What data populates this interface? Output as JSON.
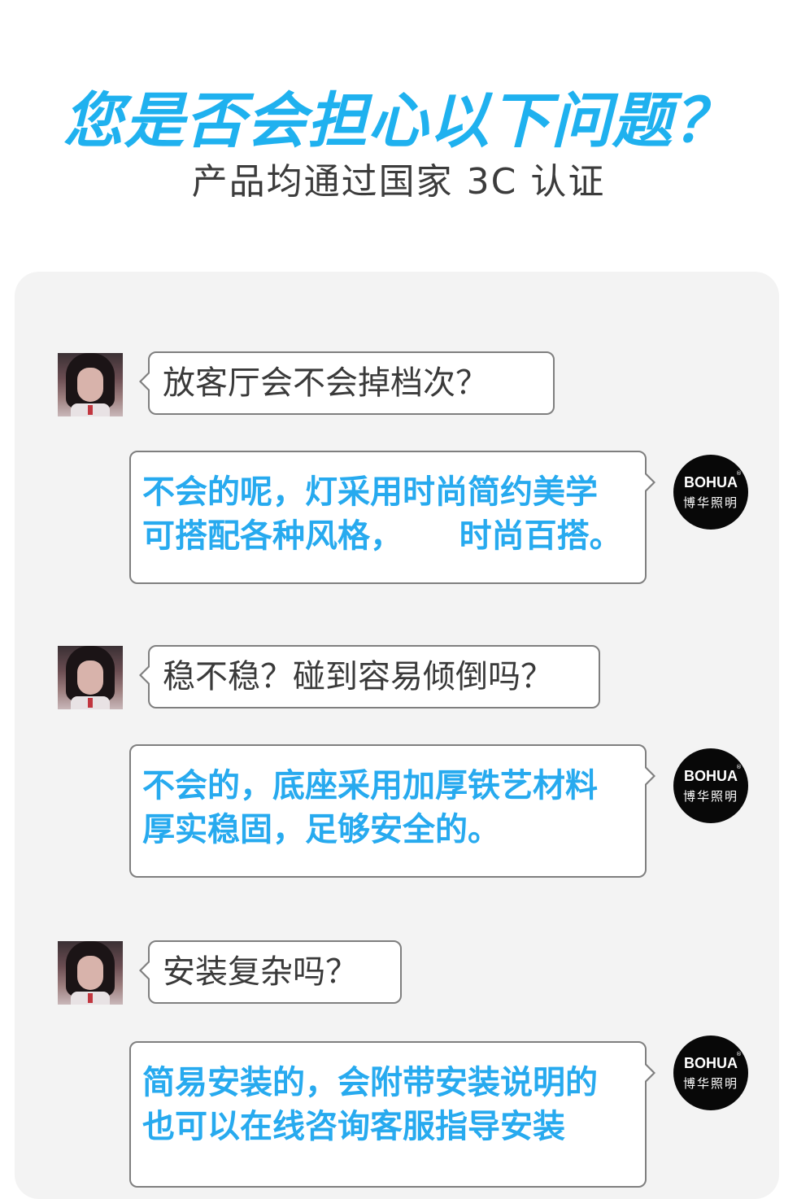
{
  "header": {
    "title": "您是否会担心以下问题？",
    "subtitle": "产品均通过国家 3C 认证"
  },
  "brand": {
    "logo_text": "BOHUA",
    "logo_mark": "®",
    "logo_cn": "博华照明"
  },
  "colors": {
    "accent": "#1fb1ef",
    "answer_text": "#27aaef",
    "question_text": "#3a3a3a",
    "panel_bg": "#f3f3f3",
    "bubble_border": "#7f7f7f",
    "logo_bg": "#080808"
  },
  "conversation": [
    {
      "question": "放客厅会不会掉档次？",
      "answer_lines": [
        "不会的呢，灯采用时尚简约美学",
        "可搭配各种风格，     时尚百搭。"
      ]
    },
    {
      "question": "稳不稳？碰到容易倾倒吗？",
      "answer_lines": [
        "不会的，底座采用加厚铁艺材料",
        "厚实稳固，足够安全的。"
      ]
    },
    {
      "question": "安装复杂吗？",
      "answer_lines": [
        "简易安装的，会附带安装说明的",
        "也可以在线咨询客服指导安装"
      ]
    }
  ]
}
